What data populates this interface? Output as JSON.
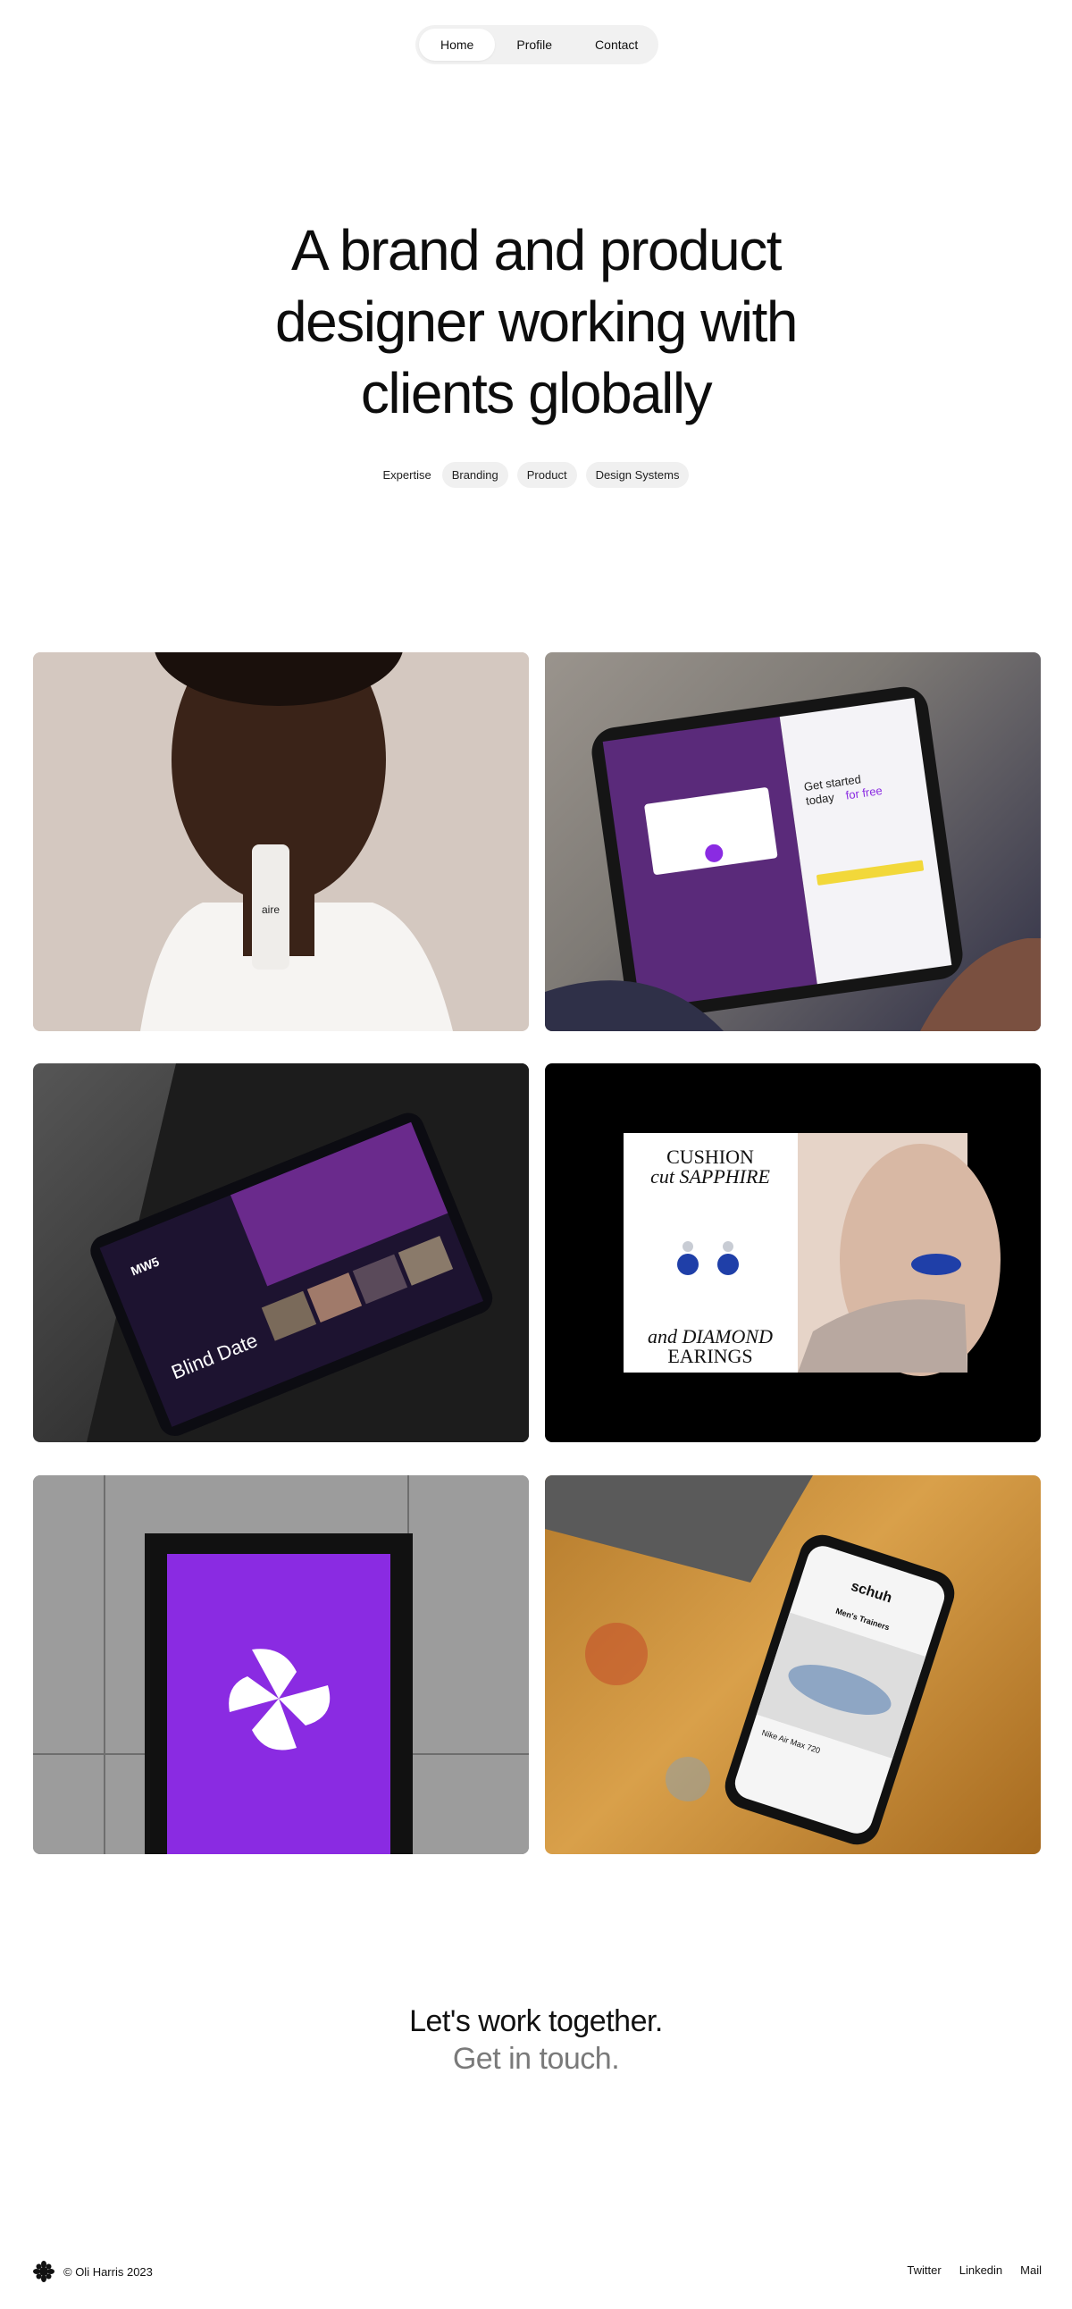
{
  "nav": {
    "items": [
      {
        "label": "Home",
        "active": true
      },
      {
        "label": "Profile",
        "active": false
      },
      {
        "label": "Contact",
        "active": false
      }
    ]
  },
  "hero": {
    "title_lines": [
      "A brand and product",
      "designer working with",
      "clients globally"
    ],
    "expertise_label": "Expertise",
    "tags": [
      "Branding",
      "Product",
      "Design Systems"
    ]
  },
  "projects": [
    {
      "logo": "aire"
    },
    {
      "headline_lines": [
        "Get started",
        "today"
      ],
      "headline_accent": "for free"
    },
    {
      "show_title": "Blind Date",
      "network": "MW5"
    },
    {
      "lines": [
        "CUSHION",
        "cut SAPPHIRE",
        "and DIAMOND",
        "EARINGS"
      ]
    },
    {
      "icon": "pinwheel-logo"
    },
    {
      "brand": "schuh",
      "category": "Men's Trainers",
      "product": "Nike Air Max 720"
    }
  ],
  "cta": {
    "line1": "Let's work together.",
    "line2": "Get in touch."
  },
  "footer": {
    "copyright": "© Oli Harris 2023",
    "links": [
      "Twitter",
      "Linkedin",
      "Mail"
    ]
  },
  "colors": {
    "accent_purple": "#8a2be2",
    "yellow": "#f2d83a"
  }
}
